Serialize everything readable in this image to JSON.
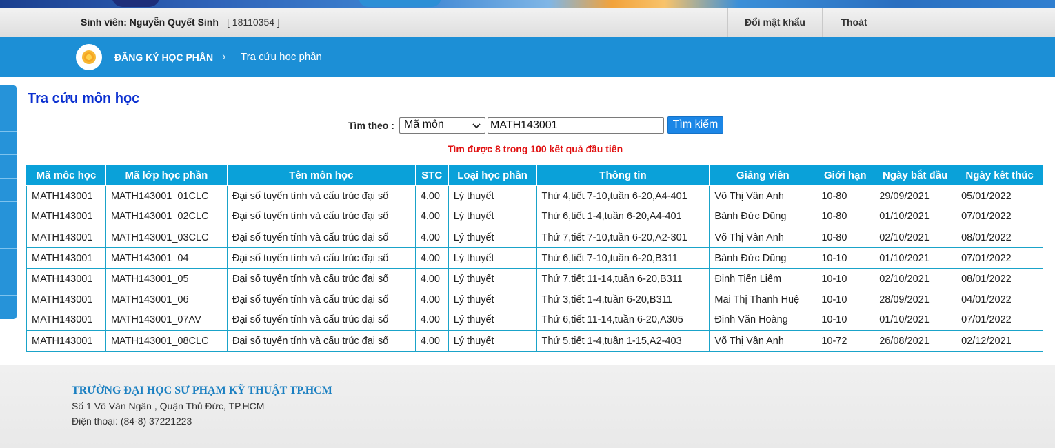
{
  "userbar": {
    "student_label": "Sinh viên: Nguyễn Quyết Sinh",
    "student_id": "[ 18110354 ]",
    "change_password": "Đổi mật khẩu",
    "logout": "Thoát"
  },
  "nav": {
    "home_icon": "flower-logo-icon",
    "breadcrumb_main": "ĐĂNG KÝ HỌC PHẦN",
    "breadcrumb_sep": "›",
    "breadcrumb_sub": "Tra cứu học phần"
  },
  "main": {
    "title": "Tra cứu môn học",
    "search": {
      "label": "Tìm theo :",
      "select_value": "Mã môn",
      "input_value": "MATH143001",
      "button": "Tìm kiếm"
    },
    "result_note": "Tìm được 8 trong 100 kết quả đầu tiên"
  },
  "table": {
    "headers": [
      "Mã môc học",
      "Mã lớp học phần",
      "Tên môn học",
      "STC",
      "Loại học phần",
      "Thông tin",
      "Giảng viên",
      "Giới hạn",
      "Ngày bắt đầu",
      "Ngày kêt thúc"
    ],
    "rows": [
      [
        "MATH143001",
        "MATH143001_01CLC",
        "Đại số tuyến tính và cấu trúc đại số",
        "4.00",
        "Lý thuyết",
        "Thứ 4,tiết 7-10,tuần 6-20,A4-401",
        "Võ Thị Vân Anh",
        "10-80",
        "29/09/2021",
        "05/01/2022"
      ],
      [
        "MATH143001",
        "MATH143001_02CLC",
        "Đại số tuyến tính và cấu trúc đại số",
        "4.00",
        "Lý thuyết",
        "Thứ 6,tiết 1-4,tuần 6-20,A4-401",
        "Bành Đức Dũng",
        "10-80",
        "01/10/2021",
        "07/01/2022"
      ],
      [
        "MATH143001",
        "MATH143001_03CLC",
        "Đại số tuyến tính và cấu trúc đại số",
        "4.00",
        "Lý thuyết",
        "Thứ 7,tiết 7-10,tuần 6-20,A2-301",
        "Võ Thị Vân Anh",
        "10-80",
        "02/10/2021",
        "08/01/2022"
      ],
      [
        "MATH143001",
        "MATH143001_04",
        "Đại số tuyến tính và cấu trúc đại số",
        "4.00",
        "Lý thuyết",
        "Thứ 6,tiết 7-10,tuần 6-20,B311",
        "Bành Đức Dũng",
        "10-10",
        "01/10/2021",
        "07/01/2022"
      ],
      [
        "MATH143001",
        "MATH143001_05",
        "Đại số tuyến tính và cấu trúc đại số",
        "4.00",
        "Lý thuyết",
        "Thứ 7,tiết 11-14,tuần 6-20,B311",
        "Đinh Tiến Liêm",
        "10-10",
        "02/10/2021",
        "08/01/2022"
      ],
      [
        "MATH143001",
        "MATH143001_06",
        "Đại số tuyến tính và cấu trúc đại số",
        "4.00",
        "Lý thuyết",
        "Thứ 3,tiết 1-4,tuần 6-20,B311",
        "Mai Thị Thanh Huệ",
        "10-10",
        "28/09/2021",
        "04/01/2022"
      ],
      [
        "MATH143001",
        "MATH143001_07AV",
        "Đại số tuyến tính và cấu trúc đại số",
        "4.00",
        "Lý thuyết",
        "Thứ 6,tiết 11-14,tuần 6-20,A305",
        "Đinh Văn Hoàng",
        "10-10",
        "01/10/2021",
        "07/01/2022"
      ],
      [
        "MATH143001",
        "MATH143001_08CLC",
        "Đại số tuyến tính và cấu trúc đại số",
        "4.00",
        "Lý thuyết",
        "Thứ 5,tiết 1-4,tuần 1-15,A2-403",
        "Võ Thị Vân Anh",
        "10-72",
        "26/08/2021",
        "02/12/2021"
      ]
    ]
  },
  "footer": {
    "school": "TRƯỜNG ĐẠI HỌC SƯ PHẠM KỸ THUẬT TP.HCM",
    "address": "Số 1 Võ Văn Ngân , Quận Thủ Đức, TP.HCM",
    "phone": "Điện thoại: (84-8) 37221223"
  },
  "colors": {
    "nav_blue": "#1c8fd6",
    "header_cyan": "#0aa1d9",
    "title_blue": "#0a2fd0",
    "note_red": "#e01010",
    "button_blue": "#1b86e6",
    "school_blue": "#1a7fc1"
  }
}
